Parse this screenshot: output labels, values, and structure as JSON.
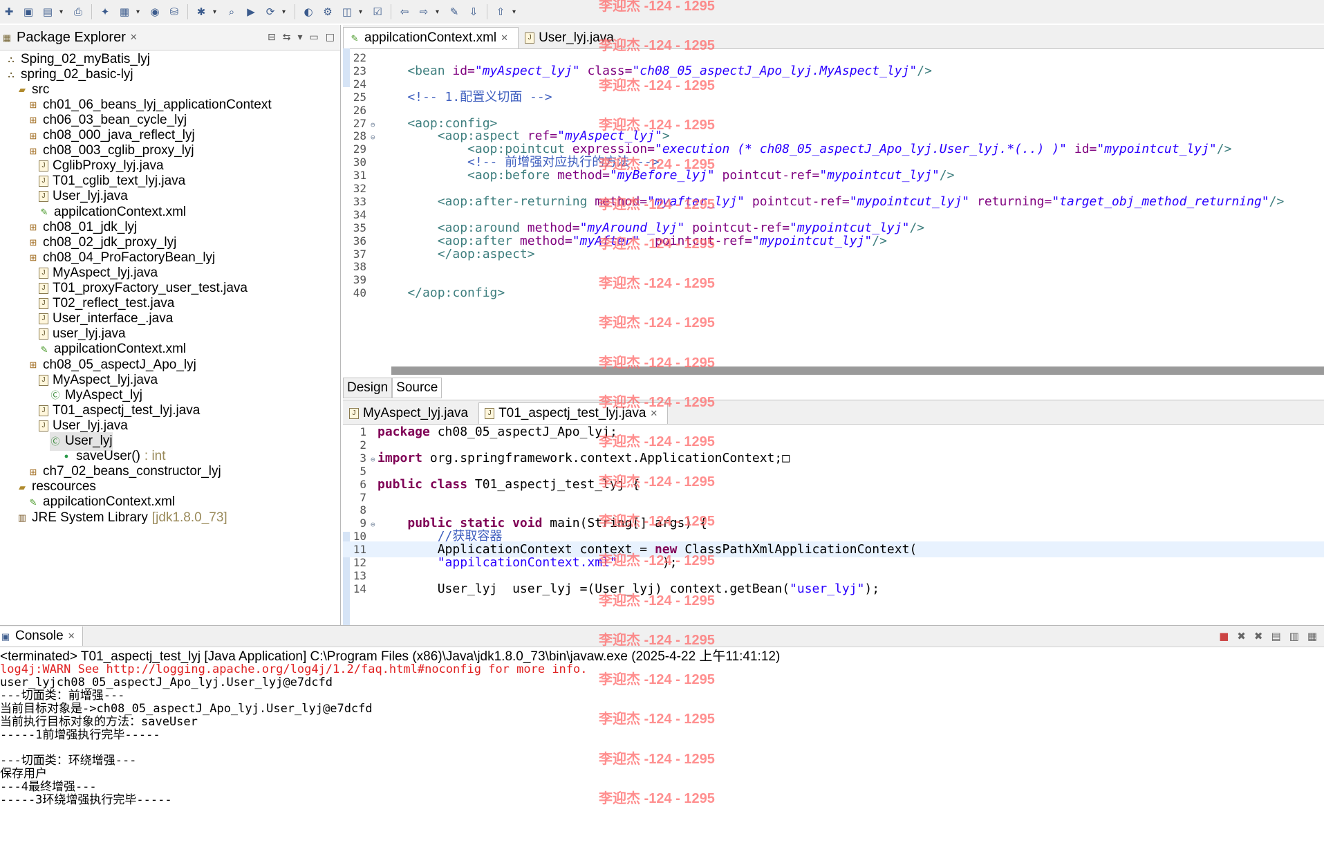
{
  "toolbar": {
    "buttons": [
      "new-icon",
      "save-icon",
      "save-all-icon",
      "print-icon",
      "new-wizard-icon",
      "package-icon",
      "class-icon",
      "server-icon",
      "debug-icon",
      "search-icon",
      "run-icon",
      "run-last-icon",
      "coverage-icon",
      "external-tools-icon",
      "open-type-icon",
      "open-task-icon",
      "back-icon",
      "forward-icon",
      "pin-icon",
      "next-annotation-icon",
      "prev-annotation-icon"
    ]
  },
  "package_explorer": {
    "title": "Package Explorer",
    "items": [
      {
        "label": "Sping_02_myBatis_lyj",
        "icon": "project-icon",
        "depth": 0
      },
      {
        "label": "spring_02_basic-lyj",
        "icon": "project-icon",
        "depth": 0
      },
      {
        "label": "src",
        "icon": "src-folder-icon",
        "depth": 1
      },
      {
        "label": "ch01_06_beans_lyj_applicationContext",
        "icon": "package-icon",
        "depth": 2
      },
      {
        "label": "ch06_03_bean_cycle_lyj",
        "icon": "package-icon",
        "depth": 2
      },
      {
        "label": "ch08_000_java_reflect_lyj",
        "icon": "package-icon",
        "depth": 2
      },
      {
        "label": "ch08_003_cglib_proxy_lyj",
        "icon": "package-icon",
        "depth": 2
      },
      {
        "label": "CglibProxy_lyj.java",
        "icon": "java-file-icon",
        "depth": 3
      },
      {
        "label": "T01_cglib_text_lyj.java",
        "icon": "java-file-icon",
        "depth": 3
      },
      {
        "label": "User_lyj.java",
        "icon": "java-file-icon",
        "depth": 3
      },
      {
        "label": "appilcationContext.xml",
        "icon": "xml-file-icon",
        "depth": 3
      },
      {
        "label": "ch08_01_jdk_lyj",
        "icon": "package-icon",
        "depth": 2
      },
      {
        "label": "ch08_02_jdk_proxy_lyj",
        "icon": "package-icon",
        "depth": 2
      },
      {
        "label": "ch08_04_ProFactoryBean_lyj",
        "icon": "package-icon",
        "depth": 2
      },
      {
        "label": "MyAspect_lyj.java",
        "icon": "java-file-icon",
        "depth": 3
      },
      {
        "label": "T01_proxyFactory_user_test.java",
        "icon": "java-file-icon",
        "depth": 3
      },
      {
        "label": "T02_reflect_test.java",
        "icon": "java-file-icon",
        "depth": 3
      },
      {
        "label": "User_interface_.java",
        "icon": "java-file-icon",
        "depth": 3
      },
      {
        "label": "user_lyj.java",
        "icon": "java-file-icon",
        "depth": 3
      },
      {
        "label": "appilcationContext.xml",
        "icon": "xml-file-icon",
        "depth": 3
      },
      {
        "label": "ch08_05_aspectJ_Apo_lyj",
        "icon": "package-icon",
        "depth": 2
      },
      {
        "label": "MyAspect_lyj.java",
        "icon": "java-file-icon",
        "depth": 3
      },
      {
        "label": "MyAspect_lyj",
        "icon": "class-icon",
        "depth": 4
      },
      {
        "label": "T01_aspectj_test_lyj.java",
        "icon": "java-file-icon",
        "depth": 3
      },
      {
        "label": "User_lyj.java",
        "icon": "java-file-icon",
        "depth": 3
      },
      {
        "label": "User_lyj",
        "icon": "class-icon",
        "depth": 4,
        "selected": true
      },
      {
        "label": "saveUser()",
        "suffix": " : int",
        "icon": "method-icon",
        "depth": 5
      },
      {
        "label": "ch7_02_beans_constructor_lyj",
        "icon": "package-icon",
        "depth": 2
      },
      {
        "label": "rescources",
        "icon": "src-folder-icon",
        "depth": 1
      },
      {
        "label": "appilcationContext.xml",
        "icon": "xml-file-icon",
        "depth": 2
      },
      {
        "label": "JRE System Library",
        "suffix": " [jdk1.8.0_73]",
        "icon": "library-icon",
        "depth": 1
      }
    ]
  },
  "xml_editor": {
    "tabs": [
      {
        "label": "appilcationContext.xml",
        "active": true,
        "closable": true
      },
      {
        "label": "User_lyj.java",
        "active": false,
        "closable": false
      }
    ],
    "lines": [
      {
        "n": "22",
        "segs": []
      },
      {
        "n": "23",
        "segs": [
          [
            "tag",
            "    <bean "
          ],
          [
            "attr",
            "id="
          ],
          [
            "val",
            "\"myAspect_lyj\""
          ],
          [
            "attr",
            " class="
          ],
          [
            "val",
            "\"ch08_05_aspectJ_Apo_lyj.MyAspect_lyj\""
          ],
          [
            "tag",
            "/>"
          ]
        ]
      },
      {
        "n": "24",
        "segs": []
      },
      {
        "n": "25",
        "segs": [
          [
            "cmt",
            "    <!-- 1.配置义切面 -->"
          ]
        ]
      },
      {
        "n": "26",
        "segs": []
      },
      {
        "n": "27",
        "fold": true,
        "segs": [
          [
            "tag",
            "    <aop:config>"
          ]
        ]
      },
      {
        "n": "28",
        "fold": true,
        "segs": [
          [
            "tag",
            "        <aop:aspect "
          ],
          [
            "attr",
            "ref="
          ],
          [
            "val",
            "\"myAspect_lyj\""
          ],
          [
            "tag",
            ">"
          ]
        ]
      },
      {
        "n": "29",
        "segs": [
          [
            "tag",
            "            <aop:pointcut "
          ],
          [
            "attr",
            "expression="
          ],
          [
            "val",
            "\"execution (* ch08_05_aspectJ_Apo_lyj.User_lyj.*(..) )\""
          ],
          [
            "attr",
            " id="
          ],
          [
            "val",
            "\"mypointcut_lyj\""
          ],
          [
            "tag",
            "/>"
          ]
        ]
      },
      {
        "n": "30",
        "segs": [
          [
            "cmt",
            "            <!-- 前增强对应执行的方法 -->"
          ]
        ]
      },
      {
        "n": "31",
        "segs": [
          [
            "tag",
            "            <aop:before "
          ],
          [
            "attr",
            "method="
          ],
          [
            "val",
            "\"myBefore_lyj\""
          ],
          [
            "attr",
            " pointcut-ref="
          ],
          [
            "val",
            "\"mypointcut_lyj\""
          ],
          [
            "tag",
            "/>"
          ]
        ]
      },
      {
        "n": "32",
        "segs": []
      },
      {
        "n": "33",
        "segs": [
          [
            "tag",
            "        <aop:after-returning "
          ],
          [
            "attr",
            "method="
          ],
          [
            "val",
            "\"myafter_lyj\""
          ],
          [
            "attr",
            " pointcut-ref="
          ],
          [
            "val",
            "\"mypointcut_lyj\""
          ],
          [
            "attr",
            " returning="
          ],
          [
            "val",
            "\"target_obj_method_returning\""
          ],
          [
            "tag",
            "/>"
          ]
        ]
      },
      {
        "n": "34",
        "segs": []
      },
      {
        "n": "35",
        "segs": [
          [
            "tag",
            "        <aop:around "
          ],
          [
            "attr",
            "method="
          ],
          [
            "val",
            "\"myAround_lyj\""
          ],
          [
            "attr",
            " pointcut-ref="
          ],
          [
            "val",
            "\"mypointcut_lyj\""
          ],
          [
            "tag",
            "/>"
          ]
        ]
      },
      {
        "n": "36",
        "segs": [
          [
            "tag",
            "        <aop:after "
          ],
          [
            "attr",
            "method="
          ],
          [
            "val",
            "\"myAfter\""
          ],
          [
            "attr",
            "  pointcut-ref="
          ],
          [
            "val",
            "\"mypointcut_lyj\""
          ],
          [
            "tag",
            "/>"
          ]
        ]
      },
      {
        "n": "37",
        "segs": [
          [
            "tag",
            "        </aop:aspect>"
          ]
        ]
      },
      {
        "n": "38",
        "segs": []
      },
      {
        "n": "39",
        "segs": []
      },
      {
        "n": "40",
        "segs": [
          [
            "tag",
            "    </aop:config>"
          ]
        ]
      }
    ],
    "mode_tabs": [
      {
        "label": "Design",
        "active": false
      },
      {
        "label": "Source",
        "active": true
      }
    ]
  },
  "java_editor": {
    "tabs": [
      {
        "label": "MyAspect_lyj.java",
        "active": false,
        "closable": false
      },
      {
        "label": "T01_aspectj_test_lyj.java",
        "active": true,
        "closable": true
      }
    ],
    "lines": [
      {
        "n": "1",
        "segs": [
          [
            "k",
            "package"
          ],
          [
            "plain",
            " ch08_05_aspectJ_Apo_lyj;"
          ]
        ]
      },
      {
        "n": "2",
        "segs": []
      },
      {
        "n": "3",
        "fold": true,
        "segs": [
          [
            "k",
            "import"
          ],
          [
            "plain",
            " org.springframework.context.ApplicationContext;□"
          ]
        ]
      },
      {
        "n": "5",
        "segs": []
      },
      {
        "n": "6",
        "segs": [
          [
            "k",
            "public class"
          ],
          [
            "plain",
            " T01_aspectj_test_lyj {"
          ]
        ]
      },
      {
        "n": "7",
        "segs": []
      },
      {
        "n": "8",
        "segs": []
      },
      {
        "n": "9",
        "fold": true,
        "segs": [
          [
            "plain",
            "    "
          ],
          [
            "k",
            "public static void"
          ],
          [
            "plain",
            " main(String[] args) {"
          ]
        ]
      },
      {
        "n": "10",
        "segs": [
          [
            "cmt",
            "        //获取容器"
          ]
        ]
      },
      {
        "n": "11",
        "highlight": true,
        "segs": [
          [
            "plain",
            "        ApplicationContext context = "
          ],
          [
            "k",
            "new"
          ],
          [
            "plain",
            " ClassPathXmlApplicationContext("
          ]
        ]
      },
      {
        "n": "12",
        "segs": [
          [
            "str",
            "        \"appilcationContext.xml\""
          ],
          [
            "plain",
            "      );"
          ]
        ]
      },
      {
        "n": "13",
        "segs": []
      },
      {
        "n": "14",
        "segs": [
          [
            "plain",
            "        User_lyj  user_lyj =(User_lyj) context.getBean("
          ],
          [
            "str",
            "\"user_lyj\""
          ],
          [
            "plain",
            ");"
          ]
        ]
      }
    ]
  },
  "console": {
    "title": "Console",
    "status": "<terminated> T01_aspectj_test_lyj [Java Application] C:\\Program Files (x86)\\Java\\jdk1.8.0_73\\bin\\javaw.exe (2025-4-22 上午11:41:12)",
    "lines": [
      {
        "text": "log4j:WARN See http://logging.apache.org/log4j/1.2/faq.html#noconfig for more info.",
        "red": true
      },
      {
        "text": "user_lyjch08_05_aspectJ_Apo_lyj.User_lyj@e7dcfd",
        "red": false
      },
      {
        "text": "---切面类：前增强---",
        "red": false
      },
      {
        "text": "当前目标对象是->ch08_05_aspectJ_Apo_lyj.User_lyj@e7dcfd",
        "red": false
      },
      {
        "text": "当前执行目标对象的方法：saveUser",
        "red": false
      },
      {
        "text": "-----1前增强执行完毕-----",
        "red": false
      },
      {
        "text": "",
        "red": false
      },
      {
        "text": "---切面类：环绕增强---",
        "red": false
      },
      {
        "text": "保存用户",
        "red": false
      },
      {
        "text": "---4最终增强---",
        "red": false
      },
      {
        "text": "-----3环绕增强执行完毕-----",
        "red": false
      }
    ]
  },
  "watermark": {
    "text": "李迎杰 -124 - 1295"
  }
}
